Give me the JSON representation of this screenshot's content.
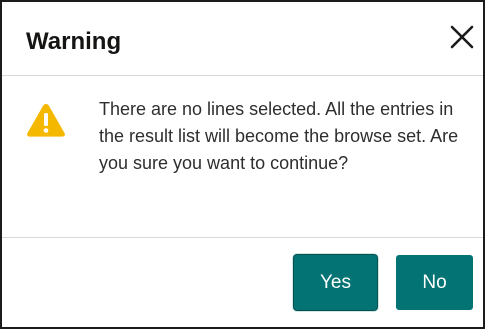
{
  "dialog": {
    "title": "Warning",
    "message": "There are no lines selected. All the entries in the result list will become the browse set. Are you sure you want to continue?",
    "icon": "warning-icon",
    "close_icon": "close-icon",
    "buttons": {
      "yes_label": "Yes",
      "no_label": "No"
    }
  },
  "colors": {
    "accent": "#037373",
    "warning": "#F5B800",
    "title_text": "#161513",
    "body_text": "#2E2E2E"
  }
}
